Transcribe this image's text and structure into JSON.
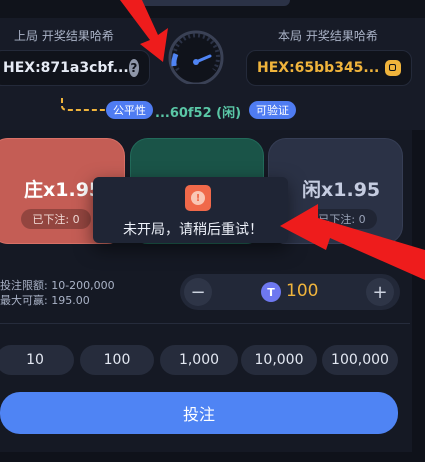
{
  "previous_round": {
    "label": "上局 开奖结果哈希",
    "hash": "HEX:871a3cbf..."
  },
  "current_round": {
    "label": "本局 开奖结果哈希",
    "hash": "HEX:65bb345..."
  },
  "fairness": {
    "badge": "公平性",
    "hash_result": "...60f52 (闲)",
    "verify_badge": "可验证"
  },
  "bets": {
    "banker": {
      "name": "庄x1.95",
      "placed": "已下注: 0",
      "color": "#c45d55"
    },
    "tie": {
      "color": "#1a5448"
    },
    "player": {
      "name": "闲x1.95",
      "placed": "已下注: 0",
      "color": "#2b3246"
    }
  },
  "toast": {
    "message": "未开局，请稍后重试！",
    "icon": "alert-icon"
  },
  "limits": {
    "range": "投注限额: 10-200,000",
    "max_win": "最大可赢: 195.00"
  },
  "stepper": {
    "minus": "−",
    "value": "100",
    "plus": "+"
  },
  "chips": [
    "10",
    "100",
    "1,000",
    "10,000",
    "100,000"
  ],
  "submit_label": "投注",
  "colors": {
    "accent": "#4f84f4",
    "gold": "#f0b43c",
    "green": "#5ac7a6"
  }
}
